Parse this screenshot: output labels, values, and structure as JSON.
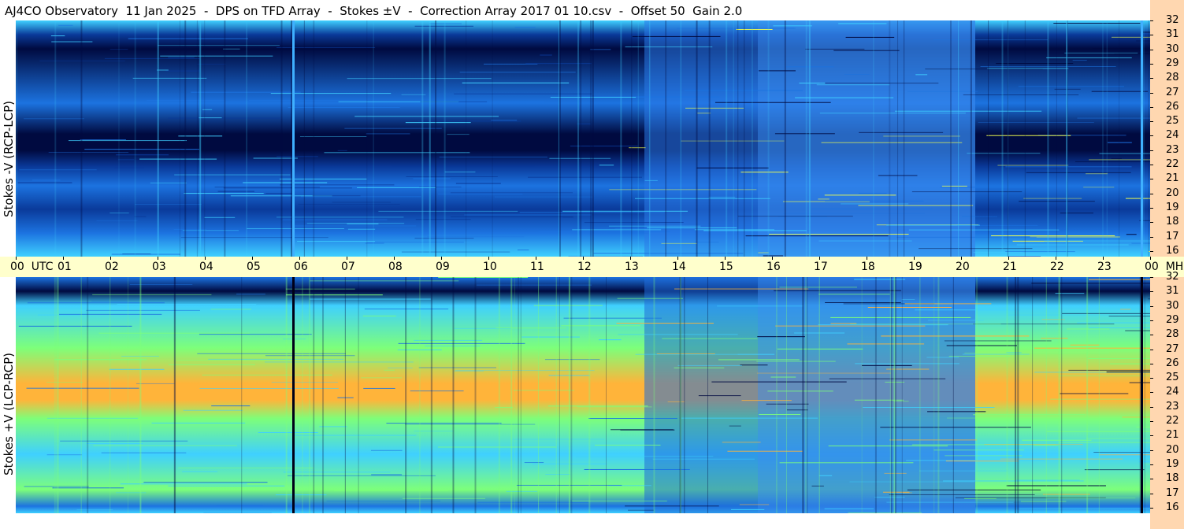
{
  "title": "AJ4CO Observatory  11 Jan 2025  -  DPS on TFD Array  -  Stokes ±V  -  Correction Array 2017 01 10.csv  -  Offset 50  Gain 2.0",
  "chart_data": [
    {
      "type": "heatmap",
      "ylabel": "Stokes -V (RCP-LCP)",
      "xlabel": "UTC",
      "x_ticks": [
        "00",
        "01",
        "02",
        "03",
        "04",
        "05",
        "06",
        "07",
        "08",
        "09",
        "10",
        "11",
        "12",
        "13",
        "14",
        "15",
        "16",
        "17",
        "18",
        "19",
        "20",
        "21",
        "22",
        "23",
        "00"
      ],
      "xlim": [
        0,
        24
      ],
      "y_ticks": [
        "32",
        "31",
        "30",
        "29",
        "28",
        "27",
        "26",
        "25",
        "24",
        "23",
        "22",
        "21",
        "20",
        "19",
        "18",
        "17",
        "16"
      ],
      "y_unit": "MHz",
      "ylim": [
        16,
        32
      ],
      "colormap": "jet",
      "dark_bands_mhz": [
        30,
        28.5,
        24.5,
        23,
        20.3
      ],
      "bright_band_mhz": [],
      "palette": {
        "deep": "#000a40",
        "low": "#0a3a9a",
        "mid": "#1c73e0",
        "high": "#3fd0ff",
        "hot": "#f0ff50"
      }
    },
    {
      "type": "heatmap",
      "ylabel": "Stokes +V (LCP-RCP)",
      "xlabel": "UTC",
      "x_ticks": [
        "00",
        "01",
        "02",
        "03",
        "04",
        "05",
        "06",
        "07",
        "08",
        "09",
        "10",
        "11",
        "12",
        "13",
        "14",
        "15",
        "16",
        "17",
        "18",
        "19",
        "20",
        "21",
        "22",
        "23",
        "00"
      ],
      "xlim": [
        0,
        24
      ],
      "y_ticks": [
        "32",
        "31",
        "30",
        "29",
        "28",
        "27",
        "26",
        "25",
        "24",
        "23",
        "22",
        "21",
        "20",
        "19",
        "18",
        "17",
        "16"
      ],
      "y_unit": "MHz",
      "ylim": [
        16,
        32
      ],
      "colormap": "jet",
      "bright_band_mhz": [
        24.5
      ],
      "palette": {
        "deep": "#000a40",
        "low": "#1c73e0",
        "mid": "#3fd0ff",
        "high": "#7dff7a",
        "hot": "#ffb43a"
      }
    }
  ],
  "time_axis": {
    "labels": [
      "00  UTC",
      "01",
      "02",
      "03",
      "04",
      "05",
      "06",
      "07",
      "08",
      "09",
      "10",
      "11",
      "12",
      "13",
      "14",
      "15",
      "16",
      "17",
      "18",
      "19",
      "20",
      "21",
      "22",
      "23",
      "00  MHz"
    ]
  }
}
